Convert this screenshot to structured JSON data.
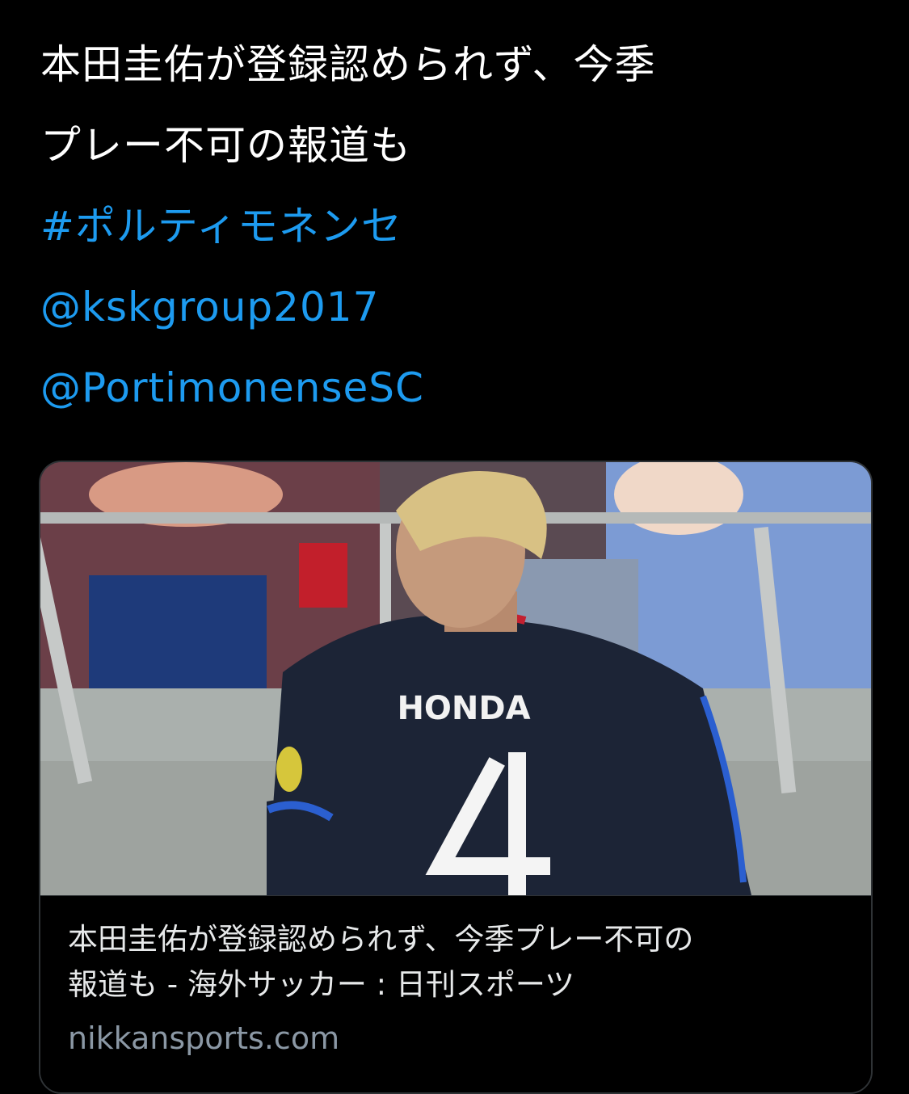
{
  "tweet": {
    "lines": [
      "本田圭佑が登録認められず、今季",
      "プレー不可の報道も"
    ],
    "hashtag": "#ポルティモネンセ",
    "mentions": [
      "@kskgroup2017",
      "@PortimonenseSC"
    ]
  },
  "link_card": {
    "image_alt": "HONDA 4",
    "jersey_name": "HONDA",
    "jersey_number": "4",
    "title_lines": [
      "本田圭佑が登録認められず、今季プレー不可の",
      "報道も - 海外サッカー : 日刊スポーツ"
    ],
    "domain": "nikkansports.com"
  },
  "colors": {
    "background": "#000000",
    "text": "#ffffff",
    "link": "#1d9bf0",
    "secondary": "#8b98a5",
    "card_border": "#2f3336"
  }
}
